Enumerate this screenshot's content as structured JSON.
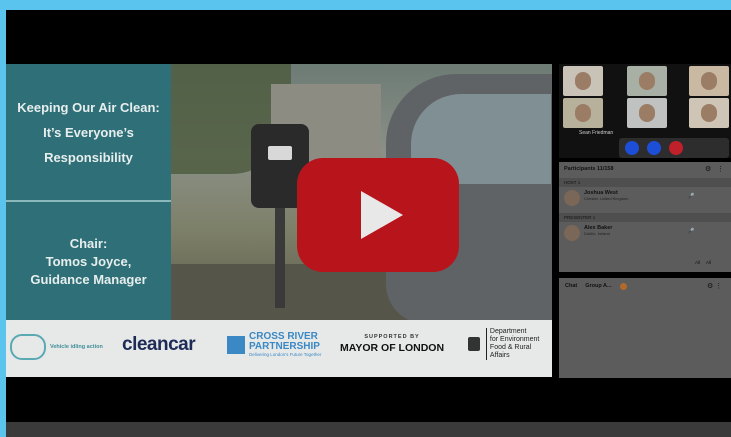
{
  "slide": {
    "title_lines": [
      "Keeping Our Air Clean:",
      "It’s Everyone’s",
      "Responsibility"
    ],
    "chair_lines": [
      "Chair:",
      "Tomos Joyce,",
      "Guidance Manager"
    ],
    "logos": {
      "noidle": "Vehicle idling action",
      "cleancar": "cleancar",
      "crossriver_1": "CROSS RIVER",
      "crossriver_2": "PARTNERSHIP",
      "crossriver_tag": "Delivering London's Future Together",
      "mayor_support": "SUPPORTED BY",
      "mayor_name": "MAYOR OF LONDON",
      "defra_1": "Department",
      "defra_2": "for Environment",
      "defra_3": "Food & Rural Affairs"
    }
  },
  "video_call": {
    "speaker_label": "Sean Friedman",
    "participants_title": "Participants 11/158",
    "host_section": "HOST",
    "host_count": "1",
    "host_name": "Joshua West",
    "host_location": "Chester, United Kingdom",
    "presenter_section": "PRESENTER",
    "presenter_count": "1",
    "presenter_name": "Alex Baker",
    "presenter_location": "Dublin, Ireland",
    "footer_all_1": "All",
    "footer_all_2": "All",
    "chat_tab": "Chat",
    "group_tab": "Group A..."
  },
  "colors": {
    "page_bg": "#5bc4ee",
    "slide_panel": "#2f6f77",
    "play_button": "#b8141b"
  }
}
